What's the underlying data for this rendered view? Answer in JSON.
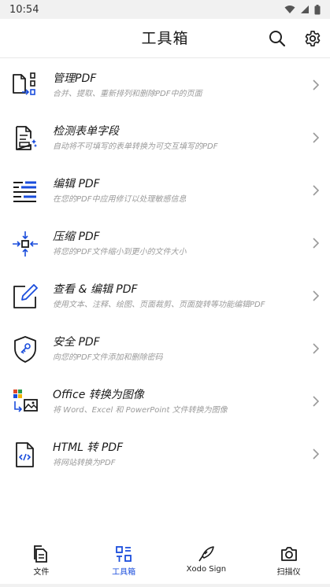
{
  "status_bar": {
    "time": "10:54"
  },
  "app_bar": {
    "title": "工具箱",
    "search_icon": "search-icon",
    "settings_icon": "gear-icon"
  },
  "tools": [
    {
      "title": "管理PDF",
      "desc": "合并、提取、重新排列和删除PDF中的页面",
      "icon": "manage-pages-icon"
    },
    {
      "title": "检测表单字段",
      "desc": "自动将不可填写的表单转换为可交互填写的PDF",
      "icon": "form-detect-icon"
    },
    {
      "title": "编辑 PDF",
      "desc": "在您的PDF中应用修订以处理敏感信息",
      "icon": "redact-icon"
    },
    {
      "title": "压缩 PDF",
      "desc": "将您的PDF文件缩小到更小的文件大小",
      "icon": "compress-icon"
    },
    {
      "title": "查看 & 编辑 PDF",
      "desc": "使用文本、注释、绘图、页面裁剪、页面旋转等功能编辑PDF",
      "icon": "view-edit-icon"
    },
    {
      "title": "安全 PDF",
      "desc": "向您的PDF文件添加和删除密码",
      "icon": "security-shield-icon"
    },
    {
      "title": "Office 转换为图像",
      "desc": "将 Word、Excel 和 PowerPoint 文件转换为图像",
      "icon": "office-to-image-icon"
    },
    {
      "title": "HTML 转 PDF",
      "desc": "将网站转换为PDF",
      "icon": "html-to-pdf-icon"
    }
  ],
  "bottom_nav": [
    {
      "label": "文件",
      "icon": "files-icon",
      "active": false
    },
    {
      "label": "工具箱",
      "icon": "toolbox-icon",
      "active": true
    },
    {
      "label": "Xodo Sign",
      "icon": "sign-pen-icon",
      "active": false
    },
    {
      "label": "扫描仪",
      "icon": "camera-icon",
      "active": false
    }
  ],
  "colors": {
    "accent": "#1a4ddc",
    "text": "#1a1a1a",
    "muted": "#9b9b9b"
  }
}
